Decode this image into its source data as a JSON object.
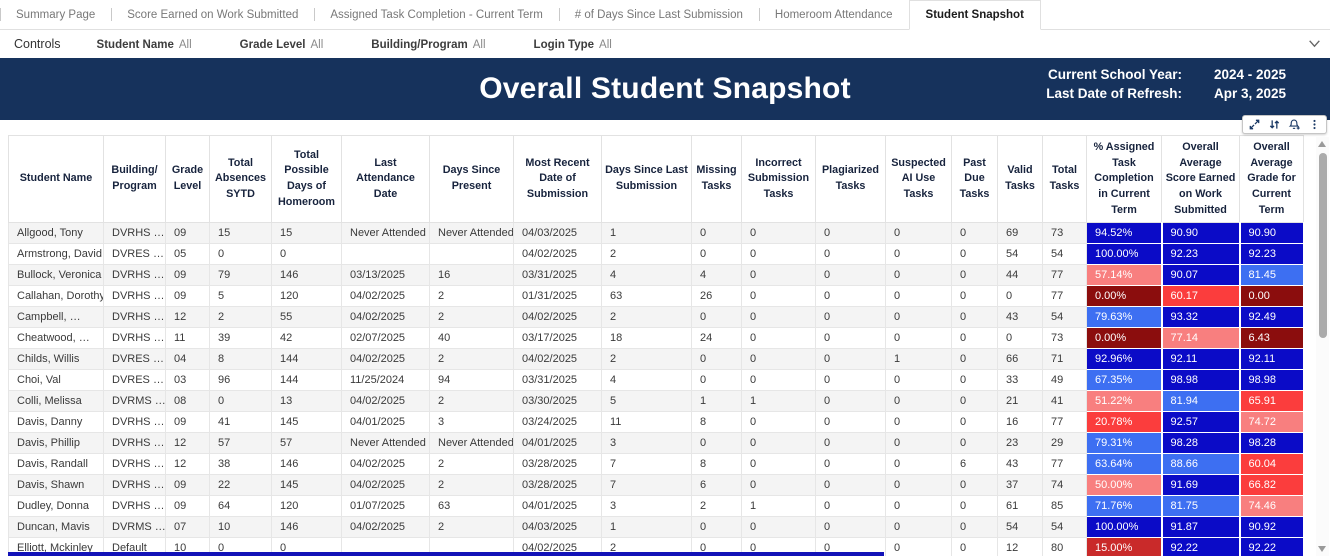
{
  "tabs": [
    {
      "label": "Summary Page",
      "active": false
    },
    {
      "label": "Score Earned on Work Submitted",
      "active": false
    },
    {
      "label": "Assigned Task Completion - Current Term",
      "active": false
    },
    {
      "label": "# of Days Since Last Submission",
      "active": false
    },
    {
      "label": "Homeroom Attendance",
      "active": false
    },
    {
      "label": "Student Snapshot",
      "active": true
    }
  ],
  "controls": {
    "label": "Controls",
    "filters": [
      {
        "name": "Student Name",
        "value": "All"
      },
      {
        "name": "Grade Level",
        "value": "All"
      },
      {
        "name": "Building/Program",
        "value": "All"
      },
      {
        "name": "Login Type",
        "value": "All"
      }
    ]
  },
  "banner": {
    "title": "Overall Student Snapshot",
    "info": [
      {
        "label": "Current School Year:",
        "value": "2024 - 2025"
      },
      {
        "label": "Last Date of Refresh:",
        "value": "Apr 3, 2025"
      }
    ]
  },
  "toolbar": {
    "icons": [
      "expand-icon",
      "sort-icon",
      "alert-add-icon",
      "more-options-icon"
    ]
  },
  "palette": {
    "banner_navy": "#16325c",
    "navy": "#0b0bc7",
    "blue": "#3d6ff2",
    "red": "#fb3d3d",
    "salmon": "#f87f7f",
    "maroon": "#8b0d0d",
    "crimson": "#c92a2a"
  },
  "table": {
    "columns": [
      "Student Name",
      "Building/ Program",
      "Grade Level",
      "Total Absences SYTD",
      "Total Possible Days of Homeroom",
      "Last Attendance Date",
      "Days Since Present",
      "Most Recent Date of Submission",
      "Days Since Last Submission",
      "Missing Tasks",
      "Incorrect Submission Tasks",
      "Plagiarized Tasks",
      "Suspected AI Use Tasks",
      "Past Due Tasks",
      "Valid Tasks",
      "Total Tasks",
      "% Assigned Task Completion in Current Term",
      "Overall Average Score Earned on Work Submitted",
      "Overall Average Grade for Current Term"
    ],
    "rows": [
      {
        "cells": [
          "Allgood, Tony",
          "DVRHS …",
          "09",
          "15",
          "15",
          "Never Attended",
          "Never Attended",
          "04/03/2025",
          "1",
          "0",
          "0",
          "0",
          "0",
          "0",
          "69",
          "73"
        ],
        "colored": [
          [
            "94.52%",
            "navy"
          ],
          [
            "90.90",
            "navy"
          ],
          [
            "90.90",
            "navy"
          ]
        ]
      },
      {
        "cells": [
          "Armstrong, David",
          "DVRES …",
          "05",
          "0",
          "0",
          "",
          "",
          "04/02/2025",
          "2",
          "0",
          "0",
          "0",
          "0",
          "0",
          "54",
          "54"
        ],
        "colored": [
          [
            "100.00%",
            "navy"
          ],
          [
            "92.23",
            "navy"
          ],
          [
            "92.23",
            "navy"
          ]
        ]
      },
      {
        "cells": [
          "Bullock, Veronica",
          "DVRHS …",
          "09",
          "79",
          "146",
          "03/13/2025",
          "16",
          "03/31/2025",
          "4",
          "4",
          "0",
          "0",
          "0",
          "0",
          "44",
          "77"
        ],
        "colored": [
          [
            "57.14%",
            "salmon"
          ],
          [
            "90.07",
            "navy"
          ],
          [
            "81.45",
            "blue"
          ]
        ]
      },
      {
        "cells": [
          "Callahan, Dorothy",
          "DVRHS …",
          "09",
          "5",
          "120",
          "04/02/2025",
          "2",
          "01/31/2025",
          "63",
          "26",
          "0",
          "0",
          "0",
          "0",
          "0",
          "77"
        ],
        "colored": [
          [
            "0.00%",
            "maroon"
          ],
          [
            "60.17",
            "red"
          ],
          [
            "0.00",
            "maroon"
          ]
        ]
      },
      {
        "cells": [
          "Campbell, …",
          "DVRHS …",
          "12",
          "2",
          "55",
          "04/02/2025",
          "2",
          "04/02/2025",
          "2",
          "0",
          "0",
          "0",
          "0",
          "0",
          "43",
          "54"
        ],
        "colored": [
          [
            "79.63%",
            "blue"
          ],
          [
            "93.32",
            "navy"
          ],
          [
            "92.49",
            "navy"
          ]
        ]
      },
      {
        "cells": [
          "Cheatwood, …",
          "DVRHS …",
          "11",
          "39",
          "42",
          "02/07/2025",
          "40",
          "03/17/2025",
          "18",
          "24",
          "0",
          "0",
          "0",
          "0",
          "0",
          "73"
        ],
        "colored": [
          [
            "0.00%",
            "maroon"
          ],
          [
            "77.14",
            "salmon"
          ],
          [
            "6.43",
            "maroon"
          ]
        ]
      },
      {
        "cells": [
          "Childs, Willis",
          "DVRES …",
          "04",
          "8",
          "144",
          "04/02/2025",
          "2",
          "04/02/2025",
          "2",
          "0",
          "0",
          "0",
          "1",
          "0",
          "66",
          "71"
        ],
        "colored": [
          [
            "92.96%",
            "navy"
          ],
          [
            "92.11",
            "navy"
          ],
          [
            "92.11",
            "navy"
          ]
        ]
      },
      {
        "cells": [
          "Choi, Val",
          "DVRES …",
          "03",
          "96",
          "144",
          "11/25/2024",
          "94",
          "03/31/2025",
          "4",
          "0",
          "0",
          "0",
          "0",
          "0",
          "33",
          "49"
        ],
        "colored": [
          [
            "67.35%",
            "blue"
          ],
          [
            "98.98",
            "navy"
          ],
          [
            "98.98",
            "navy"
          ]
        ]
      },
      {
        "cells": [
          "Colli, Melissa",
          "DVRMS …",
          "08",
          "0",
          "13",
          "04/02/2025",
          "2",
          "03/30/2025",
          "5",
          "1",
          "1",
          "0",
          "0",
          "0",
          "21",
          "41"
        ],
        "colored": [
          [
            "51.22%",
            "salmon"
          ],
          [
            "81.94",
            "blue"
          ],
          [
            "65.91",
            "red"
          ]
        ]
      },
      {
        "cells": [
          "Davis, Danny",
          "DVRHS …",
          "09",
          "41",
          "145",
          "04/01/2025",
          "3",
          "03/24/2025",
          "11",
          "8",
          "0",
          "0",
          "0",
          "0",
          "16",
          "77"
        ],
        "colored": [
          [
            "20.78%",
            "red"
          ],
          [
            "92.57",
            "navy"
          ],
          [
            "74.72",
            "salmon"
          ]
        ]
      },
      {
        "cells": [
          "Davis, Phillip",
          "DVRHS …",
          "12",
          "57",
          "57",
          "Never Attended",
          "Never Attended",
          "04/01/2025",
          "3",
          "0",
          "0",
          "0",
          "0",
          "0",
          "23",
          "29"
        ],
        "colored": [
          [
            "79.31%",
            "blue"
          ],
          [
            "98.28",
            "navy"
          ],
          [
            "98.28",
            "navy"
          ]
        ]
      },
      {
        "cells": [
          "Davis, Randall",
          "DVRHS …",
          "12",
          "38",
          "146",
          "04/02/2025",
          "2",
          "03/28/2025",
          "7",
          "8",
          "0",
          "0",
          "0",
          "6",
          "43",
          "77"
        ],
        "colored": [
          [
            "63.64%",
            "blue"
          ],
          [
            "88.66",
            "blue"
          ],
          [
            "60.04",
            "red"
          ]
        ]
      },
      {
        "cells": [
          "Davis, Shawn",
          "DVRHS …",
          "09",
          "22",
          "145",
          "04/02/2025",
          "2",
          "03/28/2025",
          "7",
          "6",
          "0",
          "0",
          "0",
          "0",
          "37",
          "74"
        ],
        "colored": [
          [
            "50.00%",
            "salmon"
          ],
          [
            "91.69",
            "navy"
          ],
          [
            "66.82",
            "red"
          ]
        ]
      },
      {
        "cells": [
          "Dudley, Donna",
          "DVRHS …",
          "09",
          "64",
          "120",
          "01/07/2025",
          "63",
          "04/01/2025",
          "3",
          "2",
          "1",
          "0",
          "0",
          "0",
          "61",
          "85"
        ],
        "colored": [
          [
            "71.76%",
            "blue"
          ],
          [
            "81.75",
            "blue"
          ],
          [
            "74.46",
            "salmon"
          ]
        ]
      },
      {
        "cells": [
          "Duncan, Mavis",
          "DVRMS …",
          "07",
          "10",
          "146",
          "04/02/2025",
          "2",
          "04/03/2025",
          "1",
          "0",
          "0",
          "0",
          "0",
          "0",
          "54",
          "54"
        ],
        "colored": [
          [
            "100.00%",
            "navy"
          ],
          [
            "91.87",
            "navy"
          ],
          [
            "90.92",
            "navy"
          ]
        ]
      },
      {
        "cells": [
          "Elliott, Mckinley",
          "Default",
          "10",
          "0",
          "0",
          "",
          "",
          "04/02/2025",
          "2",
          "0",
          "0",
          "0",
          "0",
          "0",
          "12",
          "80"
        ],
        "colored": [
          [
            "15.00%",
            "crimson"
          ],
          [
            "92.22",
            "navy"
          ],
          [
            "92.22",
            "navy"
          ]
        ]
      }
    ]
  }
}
